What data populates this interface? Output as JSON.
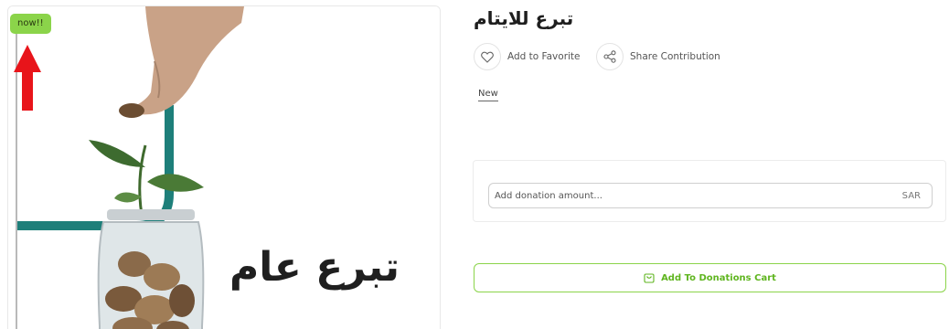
{
  "product": {
    "title": "تبرع للايتام",
    "image_text": "تبرع عام",
    "badge": "now!!",
    "tag": "New"
  },
  "actions": {
    "favorite_label": "Add to Favorite",
    "favorite_icon": "heart-icon",
    "share_label": "Share Contribution",
    "share_icon": "share-icon"
  },
  "donation": {
    "placeholder": "Add donation amount...",
    "value": "",
    "currency": "SAR"
  },
  "cart": {
    "button_label": "Add To Donations Cart",
    "icon": "cart-icon"
  },
  "colors": {
    "accent_green": "#8bd44a",
    "button_text_green": "#5fb51f",
    "arrow_red": "#e8141a",
    "frame_teal": "#1e7f7a"
  }
}
